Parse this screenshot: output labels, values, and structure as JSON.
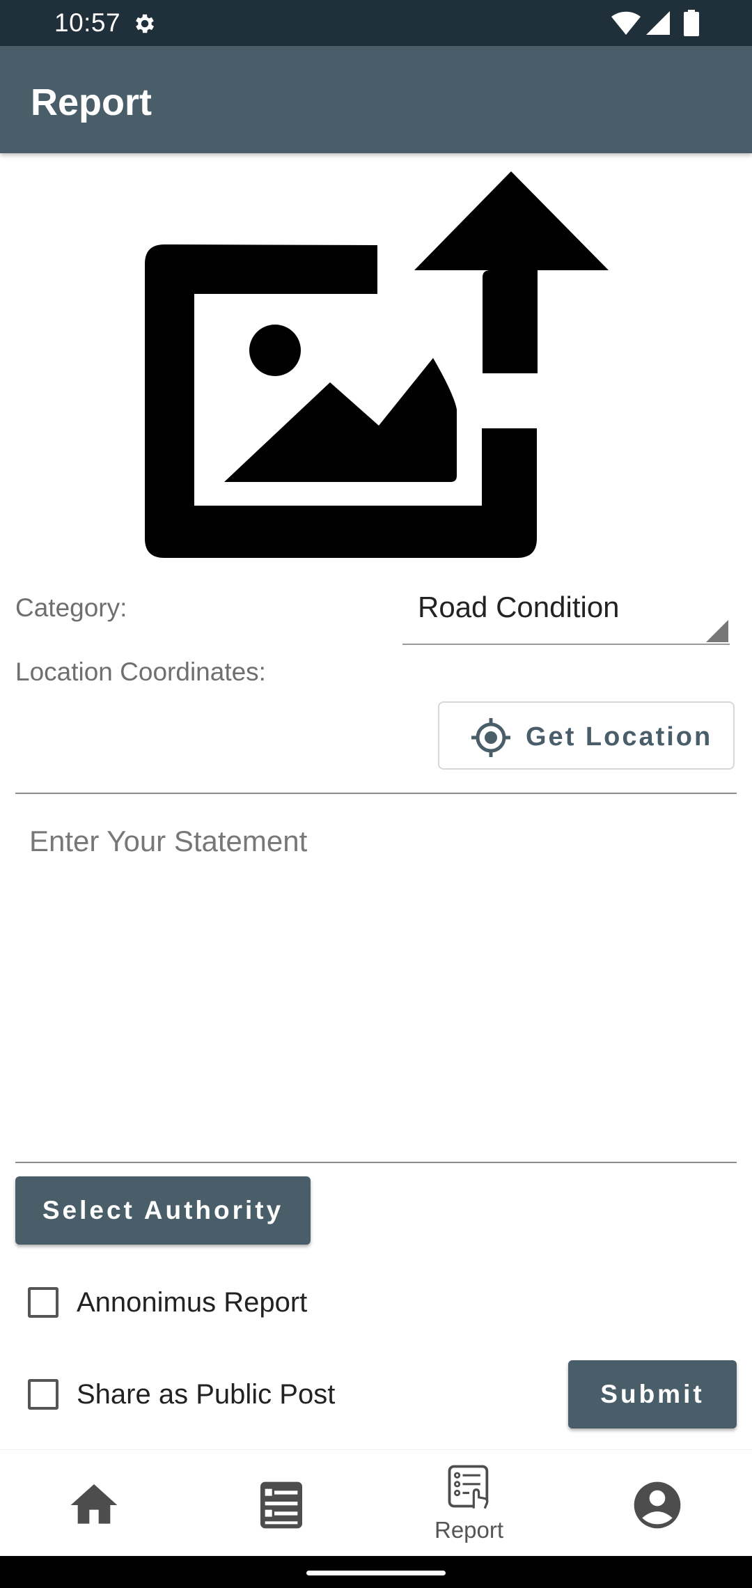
{
  "status_bar": {
    "time": "10:57",
    "icons": [
      "settings-gear-icon",
      "wifi-icon",
      "cell-signal-icon",
      "battery-icon"
    ]
  },
  "app_bar": {
    "title": "Report"
  },
  "image_picker": {
    "icon": "add-photo-upload-icon"
  },
  "form": {
    "category_label": "Category:",
    "category_value": "Road Condition",
    "location_label": "Location Coordinates:",
    "get_location_label": "Get Location",
    "statement_placeholder": "Enter Your Statement",
    "select_authority_label": "Select Authority",
    "anonymous_label": "Annonimus Report",
    "anonymous_checked": false,
    "public_post_label": "Share as Public Post",
    "public_post_checked": false,
    "submit_label": "Submit"
  },
  "bottom_nav": {
    "items": [
      {
        "icon": "home-icon",
        "label": ""
      },
      {
        "icon": "feed-list-icon",
        "label": ""
      },
      {
        "icon": "report-form-icon",
        "label": "Report",
        "active": true
      },
      {
        "icon": "account-circle-icon",
        "label": ""
      }
    ]
  },
  "colors": {
    "status_bar": "#1f303a",
    "primary": "#4a5e6a",
    "background": "#ffffff"
  }
}
